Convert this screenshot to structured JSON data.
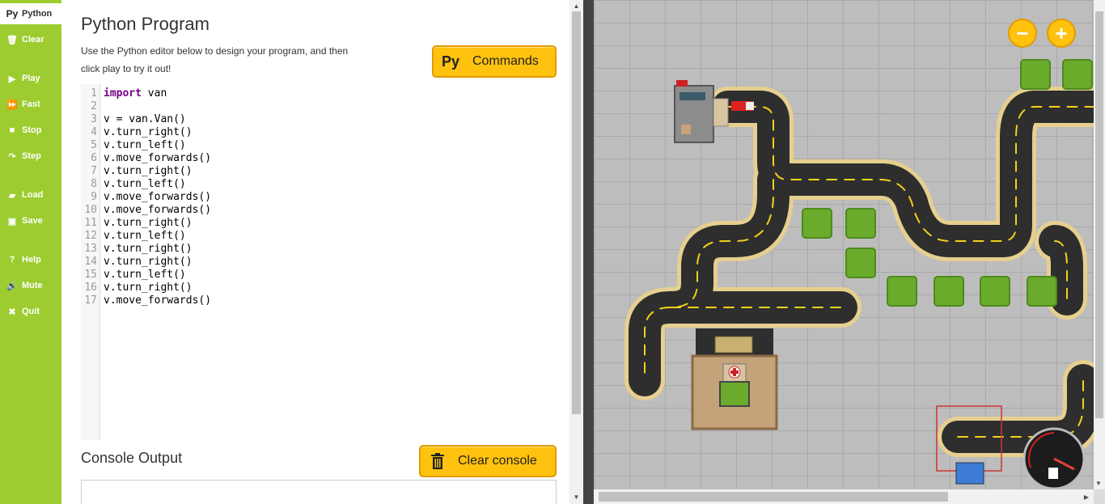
{
  "sidebar": {
    "items": [
      {
        "label": "Python",
        "icon": "Py",
        "icon_name": "python-icon",
        "active": true
      },
      {
        "label": "Clear",
        "icon": "🗑",
        "icon_name": "trash-icon"
      },
      {
        "label": "Play",
        "icon": "▶",
        "icon_name": "play-icon"
      },
      {
        "label": "Fast",
        "icon": "⏩",
        "icon_name": "fast-forward-icon"
      },
      {
        "label": "Stop",
        "icon": "■",
        "icon_name": "stop-icon"
      },
      {
        "label": "Step",
        "icon": "↷",
        "icon_name": "step-icon"
      },
      {
        "label": "Load",
        "icon": "▰",
        "icon_name": "folder-icon"
      },
      {
        "label": "Save",
        "icon": "▣",
        "icon_name": "save-icon"
      },
      {
        "label": "Help",
        "icon": "?",
        "icon_name": "help-icon"
      },
      {
        "label": "Mute",
        "icon": "🔊",
        "icon_name": "speaker-icon"
      },
      {
        "label": "Quit",
        "icon": "✖",
        "icon_name": "close-icon"
      }
    ]
  },
  "editor": {
    "title": "Python Program",
    "description": "Use the Python editor below to design your program, and then click play to try it out!",
    "commands_button": {
      "icon": "Py",
      "label": "Commands"
    },
    "code_lines": [
      {
        "n": "1",
        "kw": "import",
        "rest": " van"
      },
      {
        "n": "2",
        "kw": "",
        "rest": ""
      },
      {
        "n": "3",
        "kw": "",
        "rest": "v = van.Van()"
      },
      {
        "n": "4",
        "kw": "",
        "rest": "v.turn_right()"
      },
      {
        "n": "5",
        "kw": "",
        "rest": "v.turn_left()"
      },
      {
        "n": "6",
        "kw": "",
        "rest": "v.move_forwards()"
      },
      {
        "n": "7",
        "kw": "",
        "rest": "v.turn_right()"
      },
      {
        "n": "8",
        "kw": "",
        "rest": "v.turn_left()"
      },
      {
        "n": "9",
        "kw": "",
        "rest": "v.move_forwards()"
      },
      {
        "n": "10",
        "kw": "",
        "rest": "v.move_forwards()"
      },
      {
        "n": "11",
        "kw": "",
        "rest": "v.turn_right()"
      },
      {
        "n": "12",
        "kw": "",
        "rest": "v.turn_left()"
      },
      {
        "n": "13",
        "kw": "",
        "rest": "v.turn_right()"
      },
      {
        "n": "14",
        "kw": "",
        "rest": "v.turn_right()"
      },
      {
        "n": "15",
        "kw": "",
        "rest": "v.turn_left()"
      },
      {
        "n": "16",
        "kw": "",
        "rest": "v.turn_right()"
      },
      {
        "n": "17",
        "kw": "",
        "rest": "v.move_forwards()"
      }
    ],
    "console_title": "Console Output",
    "clear_console_label": "Clear console"
  },
  "map": {
    "zoom_out_label": "−",
    "zoom_in_label": "+"
  },
  "colors": {
    "sidebar": "#9ccc2f",
    "button_yellow": "#ffc20e",
    "road": "#2b2b2b",
    "road_edge": "#e6d08f",
    "grass": "#6aab2c"
  }
}
